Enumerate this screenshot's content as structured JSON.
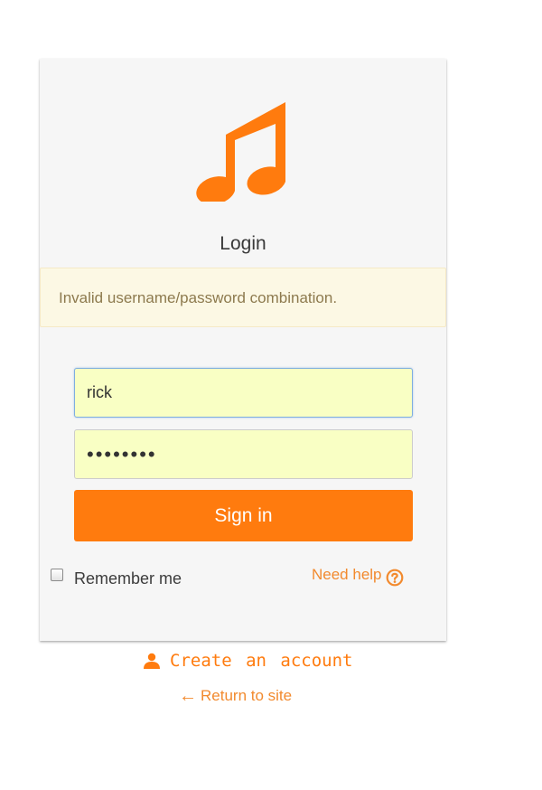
{
  "login": {
    "title": "Login",
    "alert": "Invalid username/password combination.",
    "username_value": "rick",
    "password_masked": "••••••••",
    "signin_label": "Sign in",
    "remember_label": "Remember me",
    "remember_checked": false,
    "help_label": "Need help",
    "icons": {
      "logo": "music-note-icon",
      "help": "question-circle-icon",
      "user": "user-icon",
      "arrow": "left-arrow-icon"
    }
  },
  "footer": {
    "create_account": "Create an account",
    "return_arrow": "←",
    "return_to_site": "Return to site"
  },
  "colors": {
    "accent": "#ff7b0e",
    "card_bg": "#f6f6f6",
    "alert_bg": "#fcf8e4",
    "alert_text": "#8d7a4e",
    "field_bg": "#f9ffc4"
  }
}
